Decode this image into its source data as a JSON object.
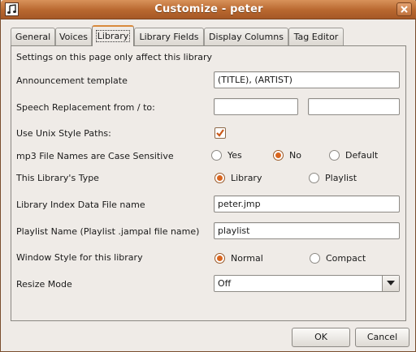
{
  "window": {
    "title": "Customize - peter"
  },
  "tabs": [
    {
      "label": "General"
    },
    {
      "label": "Voices"
    },
    {
      "label": "Library",
      "active": true
    },
    {
      "label": "Library Fields"
    },
    {
      "label": "Display Columns"
    },
    {
      "label": "Tag Editor"
    }
  ],
  "panel": {
    "info": "Settings on this page only affect this library",
    "announcement": {
      "label": "Announcement template",
      "value": "(TITLE), (ARTIST)"
    },
    "speech": {
      "label": "Speech Replacement from / to:",
      "from_value": "",
      "to_value": ""
    },
    "unix_paths": {
      "label": "Use Unix Style Paths:",
      "checked": true
    },
    "case_sensitive": {
      "label": "mp3 File Names are Case Sensitive",
      "options": [
        "Yes",
        "No",
        "Default"
      ],
      "selected": "No"
    },
    "library_type": {
      "label": "This Library's Type",
      "options": [
        "Library",
        "Playlist"
      ],
      "selected": "Library"
    },
    "index_file": {
      "label": "Library Index Data File name",
      "value": "peter.jmp"
    },
    "playlist_name": {
      "label": "Playlist Name (Playlist .jampal file name)",
      "value": "playlist"
    },
    "window_style": {
      "label": "Window Style for this library",
      "options": [
        "Normal",
        "Compact"
      ],
      "selected": "Normal"
    },
    "resize_mode": {
      "label": "Resize Mode",
      "value": "Off"
    }
  },
  "buttons": {
    "ok": "OK",
    "cancel": "Cancel"
  },
  "icons": {
    "app": "music-note-icon",
    "close": "close-icon",
    "check": "checkmark-icon",
    "dropdown": "triangle-down-icon"
  },
  "colors": {
    "titlebar": "#b8672f",
    "accent": "#d9651f",
    "background": "#efebe7"
  }
}
